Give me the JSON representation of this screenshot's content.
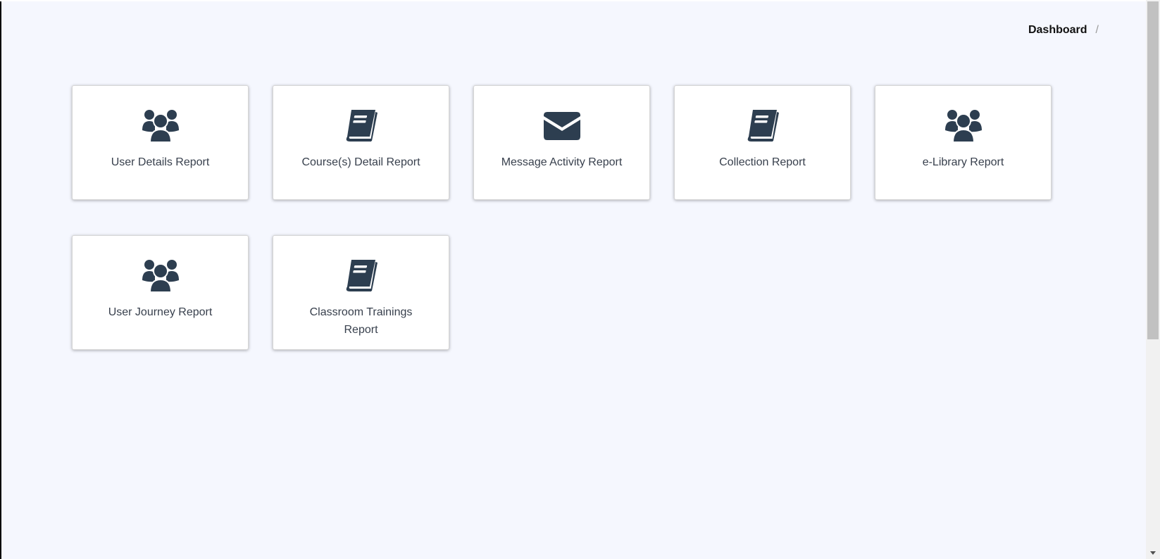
{
  "breadcrumb": {
    "current": "Dashboard",
    "separator": "/"
  },
  "colors": {
    "background": "#f5f7fe",
    "icon": "#2d3e50",
    "text": "#38404d"
  },
  "reports": [
    {
      "label": "User Details Report",
      "icon": "users-icon"
    },
    {
      "label": "Course(s) Detail Report",
      "icon": "book-icon"
    },
    {
      "label": "Message Activity Report",
      "icon": "envelope-icon"
    },
    {
      "label": "Collection Report",
      "icon": "book-icon"
    },
    {
      "label": "e-Library Report",
      "icon": "users-icon"
    },
    {
      "label": "User Journey Report",
      "icon": "users-icon"
    },
    {
      "label": "Classroom Trainings Report",
      "icon": "book-icon"
    }
  ]
}
